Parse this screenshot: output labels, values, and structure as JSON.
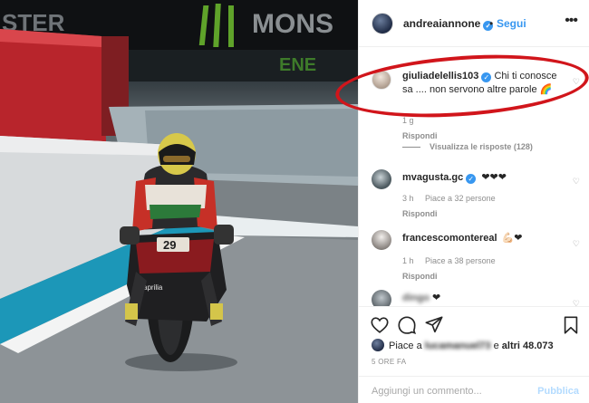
{
  "photo": {
    "banner_left": "STER",
    "banner_right": "MONS",
    "banner_sub": "ENE",
    "bike_number": "29",
    "bike_sponsor": "aprilia"
  },
  "header": {
    "username": "andreaiannone",
    "verified_mark": "✓",
    "separator": "•",
    "follow_label": "Segui",
    "more_icon": "more-horizontal-icon"
  },
  "highlight_color": "#d1151b",
  "comments": [
    {
      "author": "giuliadelellis103",
      "verified": true,
      "text": "Chi ti conosce sa .... non servono altre parole 🌈",
      "time": "",
      "likes": "",
      "reply_label": "Rispondi"
    },
    {
      "author": "mvagusta.gc",
      "verified": true,
      "text": "❤❤❤",
      "time": "3 h",
      "likes": "Piace a 32 persone",
      "reply_label": "Rispondi"
    },
    {
      "author": "francescomontereal",
      "verified": false,
      "text": "💪🏻❤",
      "time": "1 h",
      "likes": "Piace a 38 persone",
      "reply_label": "Rispondi"
    },
    {
      "author": "dingo",
      "verified": false,
      "text": "❤",
      "time": "",
      "likes": "",
      "reply_label": ""
    }
  ],
  "view_replies": "Visualizza le risposte (128)",
  "first_comment_meta": "1 g",
  "liked_by": {
    "prefix": "Piace a",
    "user": "lucamanuel73",
    "connector": "e",
    "others": "altri 48.073"
  },
  "time_ago": "5 ORE FA",
  "add_comment": {
    "placeholder": "Aggiungi un commento...",
    "publish_label": "Pubblica"
  }
}
